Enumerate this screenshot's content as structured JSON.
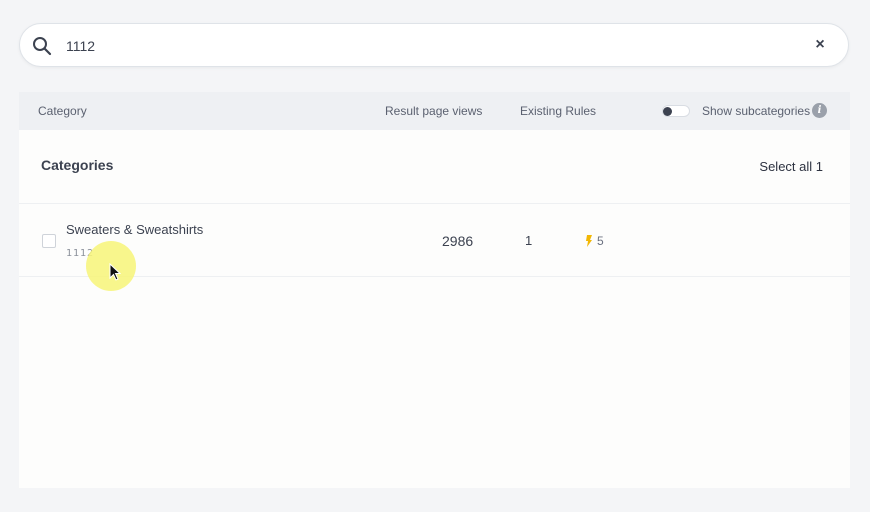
{
  "search": {
    "value": "1112",
    "clear_label": "×"
  },
  "header": {
    "category": "Category",
    "result_page_views": "Result page views",
    "existing_rules": "Existing Rules",
    "show_subcategories": "Show subcategories",
    "info_label": "i"
  },
  "panel": {
    "title": "Categories",
    "select_all": "Select all 1"
  },
  "rows": [
    {
      "name": "Sweaters & Sweatshirts",
      "id": "1112",
      "views": "2986",
      "rules": "1",
      "boost": "5"
    }
  ],
  "colors": {
    "accent": "#f2b705",
    "text": "#3c4250",
    "header_bg": "#eef0f3"
  },
  "icons": [
    "search-icon",
    "clear-icon",
    "toggle-switch",
    "info-icon",
    "bolt-icon",
    "cursor-icon"
  ]
}
